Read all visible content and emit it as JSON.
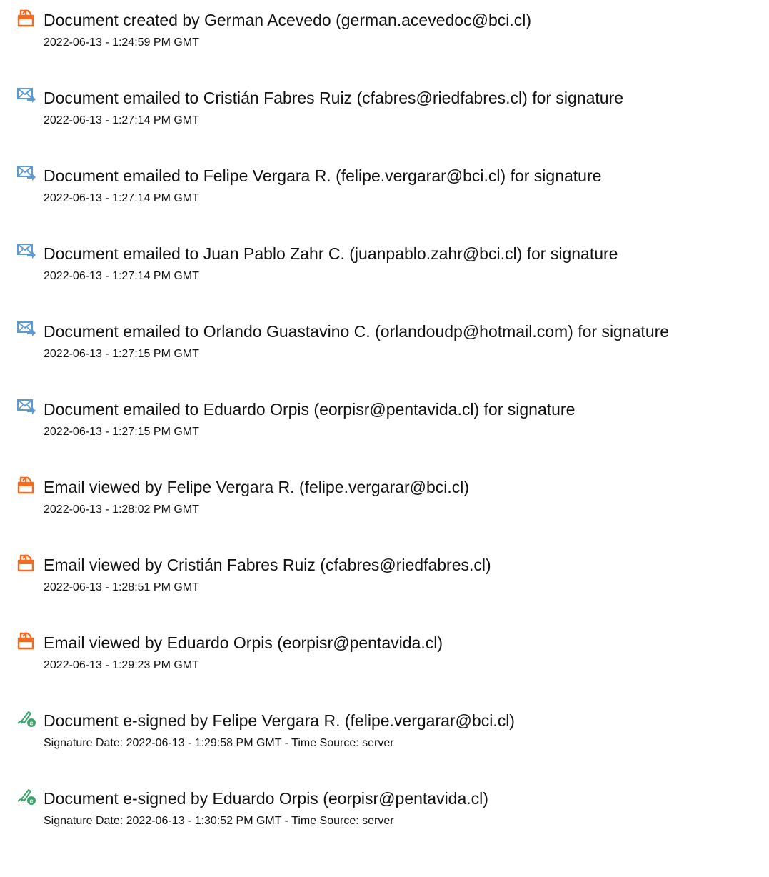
{
  "events": [
    {
      "icon": "document-created-icon",
      "title": "Document created by German Acevedo (german.acevedoc@bci.cl)",
      "time": "2022-06-13 - 1:24:59 PM GMT"
    },
    {
      "icon": "email-sent-icon",
      "title": "Document emailed to Cristián Fabres Ruiz (cfabres@riedfabres.cl) for signature",
      "time": "2022-06-13 - 1:27:14 PM GMT"
    },
    {
      "icon": "email-sent-icon",
      "title": "Document emailed to Felipe Vergara R. (felipe.vergarar@bci.cl) for signature",
      "time": "2022-06-13 - 1:27:14 PM GMT"
    },
    {
      "icon": "email-sent-icon",
      "title": "Document emailed to Juan Pablo Zahr C. (juanpablo.zahr@bci.cl) for signature",
      "time": "2022-06-13 - 1:27:14 PM GMT"
    },
    {
      "icon": "email-sent-icon",
      "title": "Document emailed to Orlando Guastavino C. (orlandoudp@hotmail.com) for signature",
      "time": "2022-06-13 - 1:27:15 PM GMT"
    },
    {
      "icon": "email-sent-icon",
      "title": "Document emailed to Eduardo Orpis (eorpisr@pentavida.cl) for signature",
      "time": "2022-06-13 - 1:27:15 PM GMT"
    },
    {
      "icon": "email-viewed-icon",
      "title": "Email viewed by Felipe Vergara R. (felipe.vergarar@bci.cl)",
      "time": "2022-06-13 - 1:28:02 PM GMT"
    },
    {
      "icon": "email-viewed-icon",
      "title": "Email viewed by Cristián Fabres Ruiz (cfabres@riedfabres.cl)",
      "time": "2022-06-13 - 1:28:51 PM GMT"
    },
    {
      "icon": "email-viewed-icon",
      "title": "Email viewed by Eduardo Orpis (eorpisr@pentavida.cl)",
      "time": "2022-06-13 - 1:29:23 PM GMT"
    },
    {
      "icon": "e-signed-icon",
      "title": "Document e-signed by Felipe Vergara R. (felipe.vergarar@bci.cl)",
      "time": "Signature Date: 2022-06-13 - 1:29:58 PM GMT - Time Source: server"
    },
    {
      "icon": "e-signed-icon",
      "title": "Document e-signed by Eduardo Orpis (eorpisr@pentavida.cl)",
      "time": "Signature Date: 2022-06-13 - 1:30:52 PM GMT - Time Source: server"
    }
  ],
  "colors": {
    "document_icon": "#f26b22",
    "email_icon": "#5b9bd5",
    "signed_icon": "#3ba56b"
  }
}
